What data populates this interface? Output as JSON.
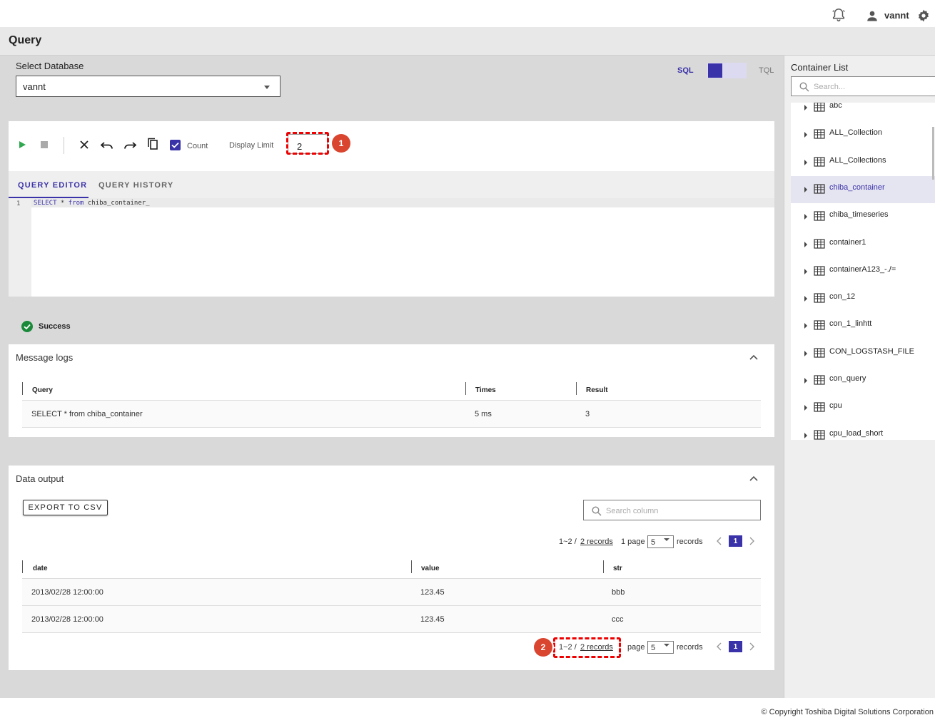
{
  "header": {
    "username": "vannt"
  },
  "page": {
    "title": "Query"
  },
  "database": {
    "label": "Select Database",
    "value": "vannt"
  },
  "mode": {
    "sql": "SQL",
    "tql": "TQL"
  },
  "toolbar": {
    "count_label": "Count",
    "display_limit_label": "Display Limit",
    "display_limit_value": "2"
  },
  "annotations": {
    "badge1": "1",
    "badge2": "2"
  },
  "tabs": {
    "editor": "QUERY EDITOR",
    "history": "QUERY HISTORY"
  },
  "editor": {
    "line_number": "1",
    "kw_select": "SELECT",
    "star": " * ",
    "kw_from": "from",
    "table": " chiba_container_"
  },
  "status": {
    "text": "Success"
  },
  "message_logs": {
    "title": "Message logs",
    "columns": [
      "Query",
      "Times",
      "Result"
    ],
    "rows": [
      {
        "query": "SELECT * from chiba_container",
        "times": "5 ms",
        "result": "3"
      }
    ]
  },
  "data_output": {
    "title": "Data output",
    "export_label": "EXPORT TO CSV",
    "search_placeholder": "Search column",
    "pager": {
      "range": "1~2 / ",
      "records_link": "2 records",
      "page_label": "1 page",
      "page_label_short": "page",
      "page_size": "5",
      "records_label": "records",
      "current_page": "1"
    },
    "columns": [
      "date",
      "value",
      "str"
    ],
    "rows": [
      {
        "date": "2013/02/28 12:00:00",
        "value": "123.45",
        "str": "bbb"
      },
      {
        "date": "2013/02/28 12:00:00",
        "value": "123.45",
        "str": "ccc"
      }
    ]
  },
  "sidebar": {
    "title": "Container List",
    "search_placeholder": "Search...",
    "items": [
      {
        "label": "abc"
      },
      {
        "label": "ALL_Collection"
      },
      {
        "label": "ALL_Collections"
      },
      {
        "label": "chiba_container"
      },
      {
        "label": "chiba_timeseries"
      },
      {
        "label": "container1"
      },
      {
        "label": "containerA123_-./="
      },
      {
        "label": "con_12"
      },
      {
        "label": "con_1_linhtt"
      },
      {
        "label": "CON_LOGSTASH_FILE"
      },
      {
        "label": "con_query"
      },
      {
        "label": "cpu"
      },
      {
        "label": "cpu_load_short"
      }
    ]
  },
  "footer": {
    "copyright": "© Copyright Toshiba Digital Solutions Corporation"
  },
  "colors": {
    "accent": "#3a32a8",
    "success": "#1a8a3a",
    "annotation": "#d9452f",
    "highlight": "#ee0000"
  }
}
